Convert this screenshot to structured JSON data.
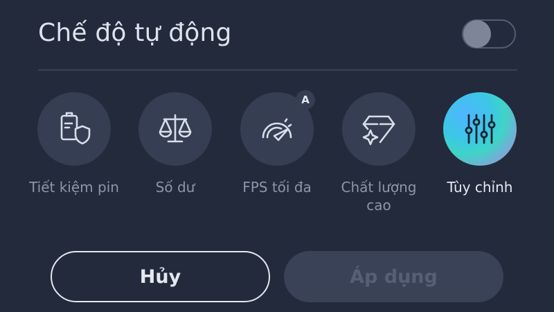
{
  "header": {
    "title": "Chế độ tự động",
    "auto_toggle_on": false
  },
  "modes": [
    {
      "label": "Tiết kiệm pin",
      "icon": "battery-shield-icon",
      "active": false
    },
    {
      "label": "Số dư",
      "icon": "balance-scale-icon",
      "active": false
    },
    {
      "label": "FPS tối đa",
      "icon": "speedometer-icon",
      "active": false,
      "badge": "A"
    },
    {
      "label": "Chất lượng cao",
      "icon": "diamond-sparkle-icon",
      "active": false
    },
    {
      "label": "Tùy chỉnh",
      "icon": "sliders-icon",
      "active": true
    }
  ],
  "actions": {
    "cancel_label": "Hủy",
    "apply_label": "Áp dụng",
    "apply_enabled": false
  },
  "colors": {
    "background": "#232a3b",
    "circle": "#353e52",
    "label_inactive": "#8d96a8",
    "label_active": "#e6eaf2"
  }
}
